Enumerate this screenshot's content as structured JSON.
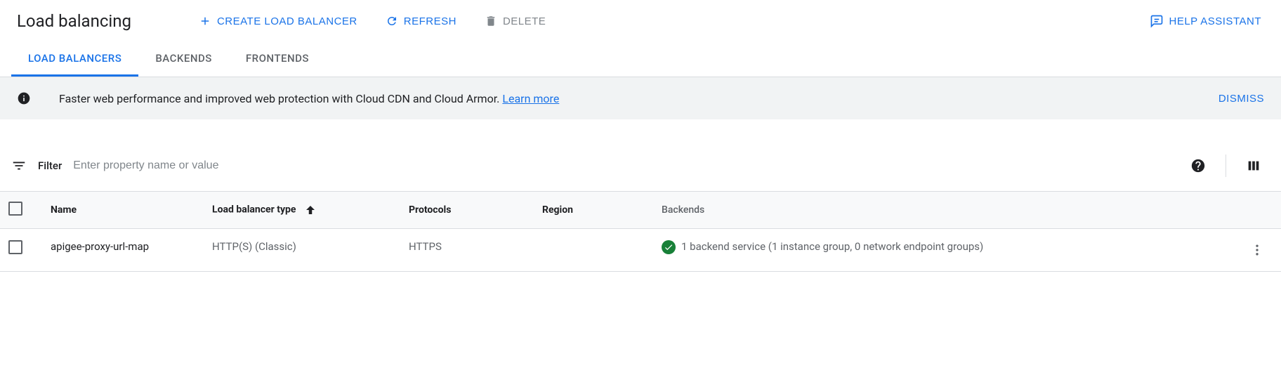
{
  "header": {
    "title": "Load balancing",
    "create_label": "CREATE LOAD BALANCER",
    "refresh_label": "REFRESH",
    "delete_label": "DELETE",
    "help_label": "HELP ASSISTANT"
  },
  "tabs": {
    "load_balancers": "LOAD BALANCERS",
    "backends": "BACKENDS",
    "frontends": "FRONTENDS"
  },
  "banner": {
    "text": "Faster web performance and improved web protection with Cloud CDN and Cloud Armor. ",
    "learn_more": "Learn more",
    "dismiss": "DISMISS"
  },
  "filter": {
    "label": "Filter",
    "placeholder": "Enter property name or value"
  },
  "table": {
    "headers": {
      "name": "Name",
      "type": "Load balancer type",
      "protocols": "Protocols",
      "region": "Region",
      "backends": "Backends"
    },
    "rows": [
      {
        "name": "apigee-proxy-url-map",
        "type": "HTTP(S) (Classic)",
        "protocols": "HTTPS",
        "region": "",
        "backends": "1 backend service (1 instance group, 0 network endpoint groups)"
      }
    ]
  }
}
